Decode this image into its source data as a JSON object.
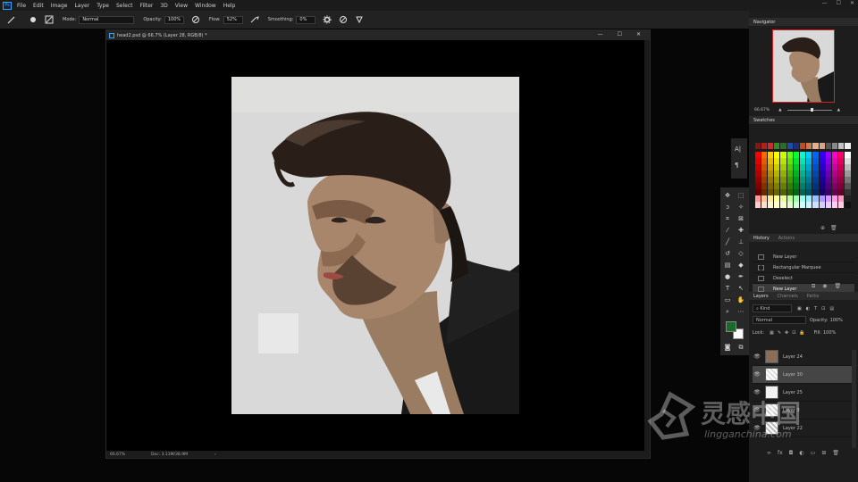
{
  "menu": {
    "logo": "Ps",
    "items": [
      "File",
      "Edit",
      "Image",
      "Layer",
      "Type",
      "Select",
      "Filter",
      "3D",
      "View",
      "Window",
      "Help"
    ],
    "window_controls": [
      "—",
      "☐",
      "✕"
    ]
  },
  "options": {
    "mode_label": "Mode:",
    "mode_value": "Normal",
    "opacity_label": "Opacity:",
    "opacity_value": "100%",
    "flow_label": "Flow:",
    "flow_value": "52%",
    "smoothing_label": "Smoothing:",
    "smoothing_value": "0%"
  },
  "document": {
    "tab_title": "head2.psd @ 66.7% (Layer 28, RGB/8) *",
    "zoom": "66.67%",
    "doc_info": "Doc: 3.13M/38.9M",
    "controls": [
      "—",
      "☐",
      "✕"
    ]
  },
  "navigator": {
    "title": "Navigator",
    "zoom": "66.67%"
  },
  "swatches": {
    "title": "Swatches",
    "colors": [
      [
        "#7a1a1a",
        "#b32020",
        "#d32a2a",
        "#2e8b2e",
        "#2a6a2a",
        "#1e4ea0",
        "#1b2f7a",
        "#b84f2a",
        "#c77b4f",
        "#e2b089",
        "#d9a58a",
        "#555555",
        "#888888",
        "#c3c3c3",
        "#eeeeee"
      ],
      [
        "#ff0000",
        "#ff6600",
        "#ffcc00",
        "#ffff00",
        "#ccff00",
        "#66ff00",
        "#00ff33",
        "#00ffcc",
        "#00ccff",
        "#0066ff",
        "#3300ff",
        "#9900ff",
        "#ff00cc",
        "#ff0066",
        "#ffffff"
      ],
      [
        "#e60000",
        "#e65c00",
        "#e6b800",
        "#e6e600",
        "#b8e600",
        "#5ce600",
        "#00e62e",
        "#00e6b8",
        "#00b8e6",
        "#005ce6",
        "#2e00e6",
        "#8a00e6",
        "#e600b8",
        "#e6005c",
        "#dddddd"
      ],
      [
        "#cc0000",
        "#cc5200",
        "#cca300",
        "#cccc00",
        "#a3cc00",
        "#52cc00",
        "#00cc29",
        "#00cca3",
        "#00a3cc",
        "#0052cc",
        "#2900cc",
        "#7a00cc",
        "#cc00a3",
        "#cc0052",
        "#bbbbbb"
      ],
      [
        "#b30000",
        "#b34700",
        "#b38f00",
        "#b3b300",
        "#8fb300",
        "#47b300",
        "#00b324",
        "#00b38f",
        "#008fb3",
        "#0047b3",
        "#2400b3",
        "#6b00b3",
        "#b3008f",
        "#b30047",
        "#999999"
      ],
      [
        "#990000",
        "#993d00",
        "#997a00",
        "#999900",
        "#7a9900",
        "#3d9900",
        "#00991f",
        "#00997a",
        "#007a99",
        "#003d99",
        "#1f0099",
        "#5c0099",
        "#99007a",
        "#99003d",
        "#777777"
      ],
      [
        "#800000",
        "#803300",
        "#806600",
        "#808000",
        "#668000",
        "#338000",
        "#00801a",
        "#008066",
        "#006680",
        "#003380",
        "#1a0080",
        "#4d0080",
        "#800066",
        "#800033",
        "#555555"
      ],
      [
        "#660000",
        "#662900",
        "#665200",
        "#666600",
        "#526600",
        "#296600",
        "#006614",
        "#006652",
        "#005266",
        "#002966",
        "#140066",
        "#3d0066",
        "#660052",
        "#660029",
        "#333333"
      ],
      [
        "#ff9999",
        "#ffc299",
        "#ffeb99",
        "#ffff99",
        "#ebff99",
        "#c2ff99",
        "#99ffad",
        "#99ffeb",
        "#99ebff",
        "#99c2ff",
        "#ad99ff",
        "#d699ff",
        "#ff99eb",
        "#ff99c2",
        "#222222"
      ],
      [
        "#ffcccc",
        "#ffe0cc",
        "#fff5cc",
        "#ffffcc",
        "#f5ffcc",
        "#e0ffcc",
        "#ccffd6",
        "#ccfff5",
        "#ccf5ff",
        "#cce0ff",
        "#d6ccff",
        "#ebccff",
        "#ffccf5",
        "#ffcce0",
        "#111111"
      ]
    ]
  },
  "history": {
    "tabs": [
      "History",
      "Actions"
    ],
    "items": [
      {
        "label": "New Layer",
        "selected": false
      },
      {
        "label": "Rectangular Marquee",
        "selected": false
      },
      {
        "label": "Deselect",
        "selected": false
      },
      {
        "label": "New Layer",
        "selected": true
      }
    ]
  },
  "layers_panel": {
    "tabs": [
      "Layers",
      "Channels",
      "Paths"
    ],
    "filter_label": "Kind",
    "blend_mode": "Normal",
    "opacity_label": "Opacity:",
    "opacity_value": "100%",
    "lock_label": "Lock:",
    "fill_label": "Fill:",
    "fill_value": "100%",
    "layers": [
      {
        "name": "Layer 24",
        "selected": false
      },
      {
        "name": "Layer 30",
        "selected": true
      },
      {
        "name": "Layer 25",
        "selected": false
      },
      {
        "name": "Layer 3",
        "selected": false
      },
      {
        "name": "Layer 22",
        "selected": false
      }
    ]
  },
  "colors": {
    "foreground": "#1a6b2a",
    "background": "#ffffff",
    "accent": "#31a8ff"
  },
  "watermark": {
    "brand_cn": "灵感中国",
    "url": "lingganchina.com"
  }
}
